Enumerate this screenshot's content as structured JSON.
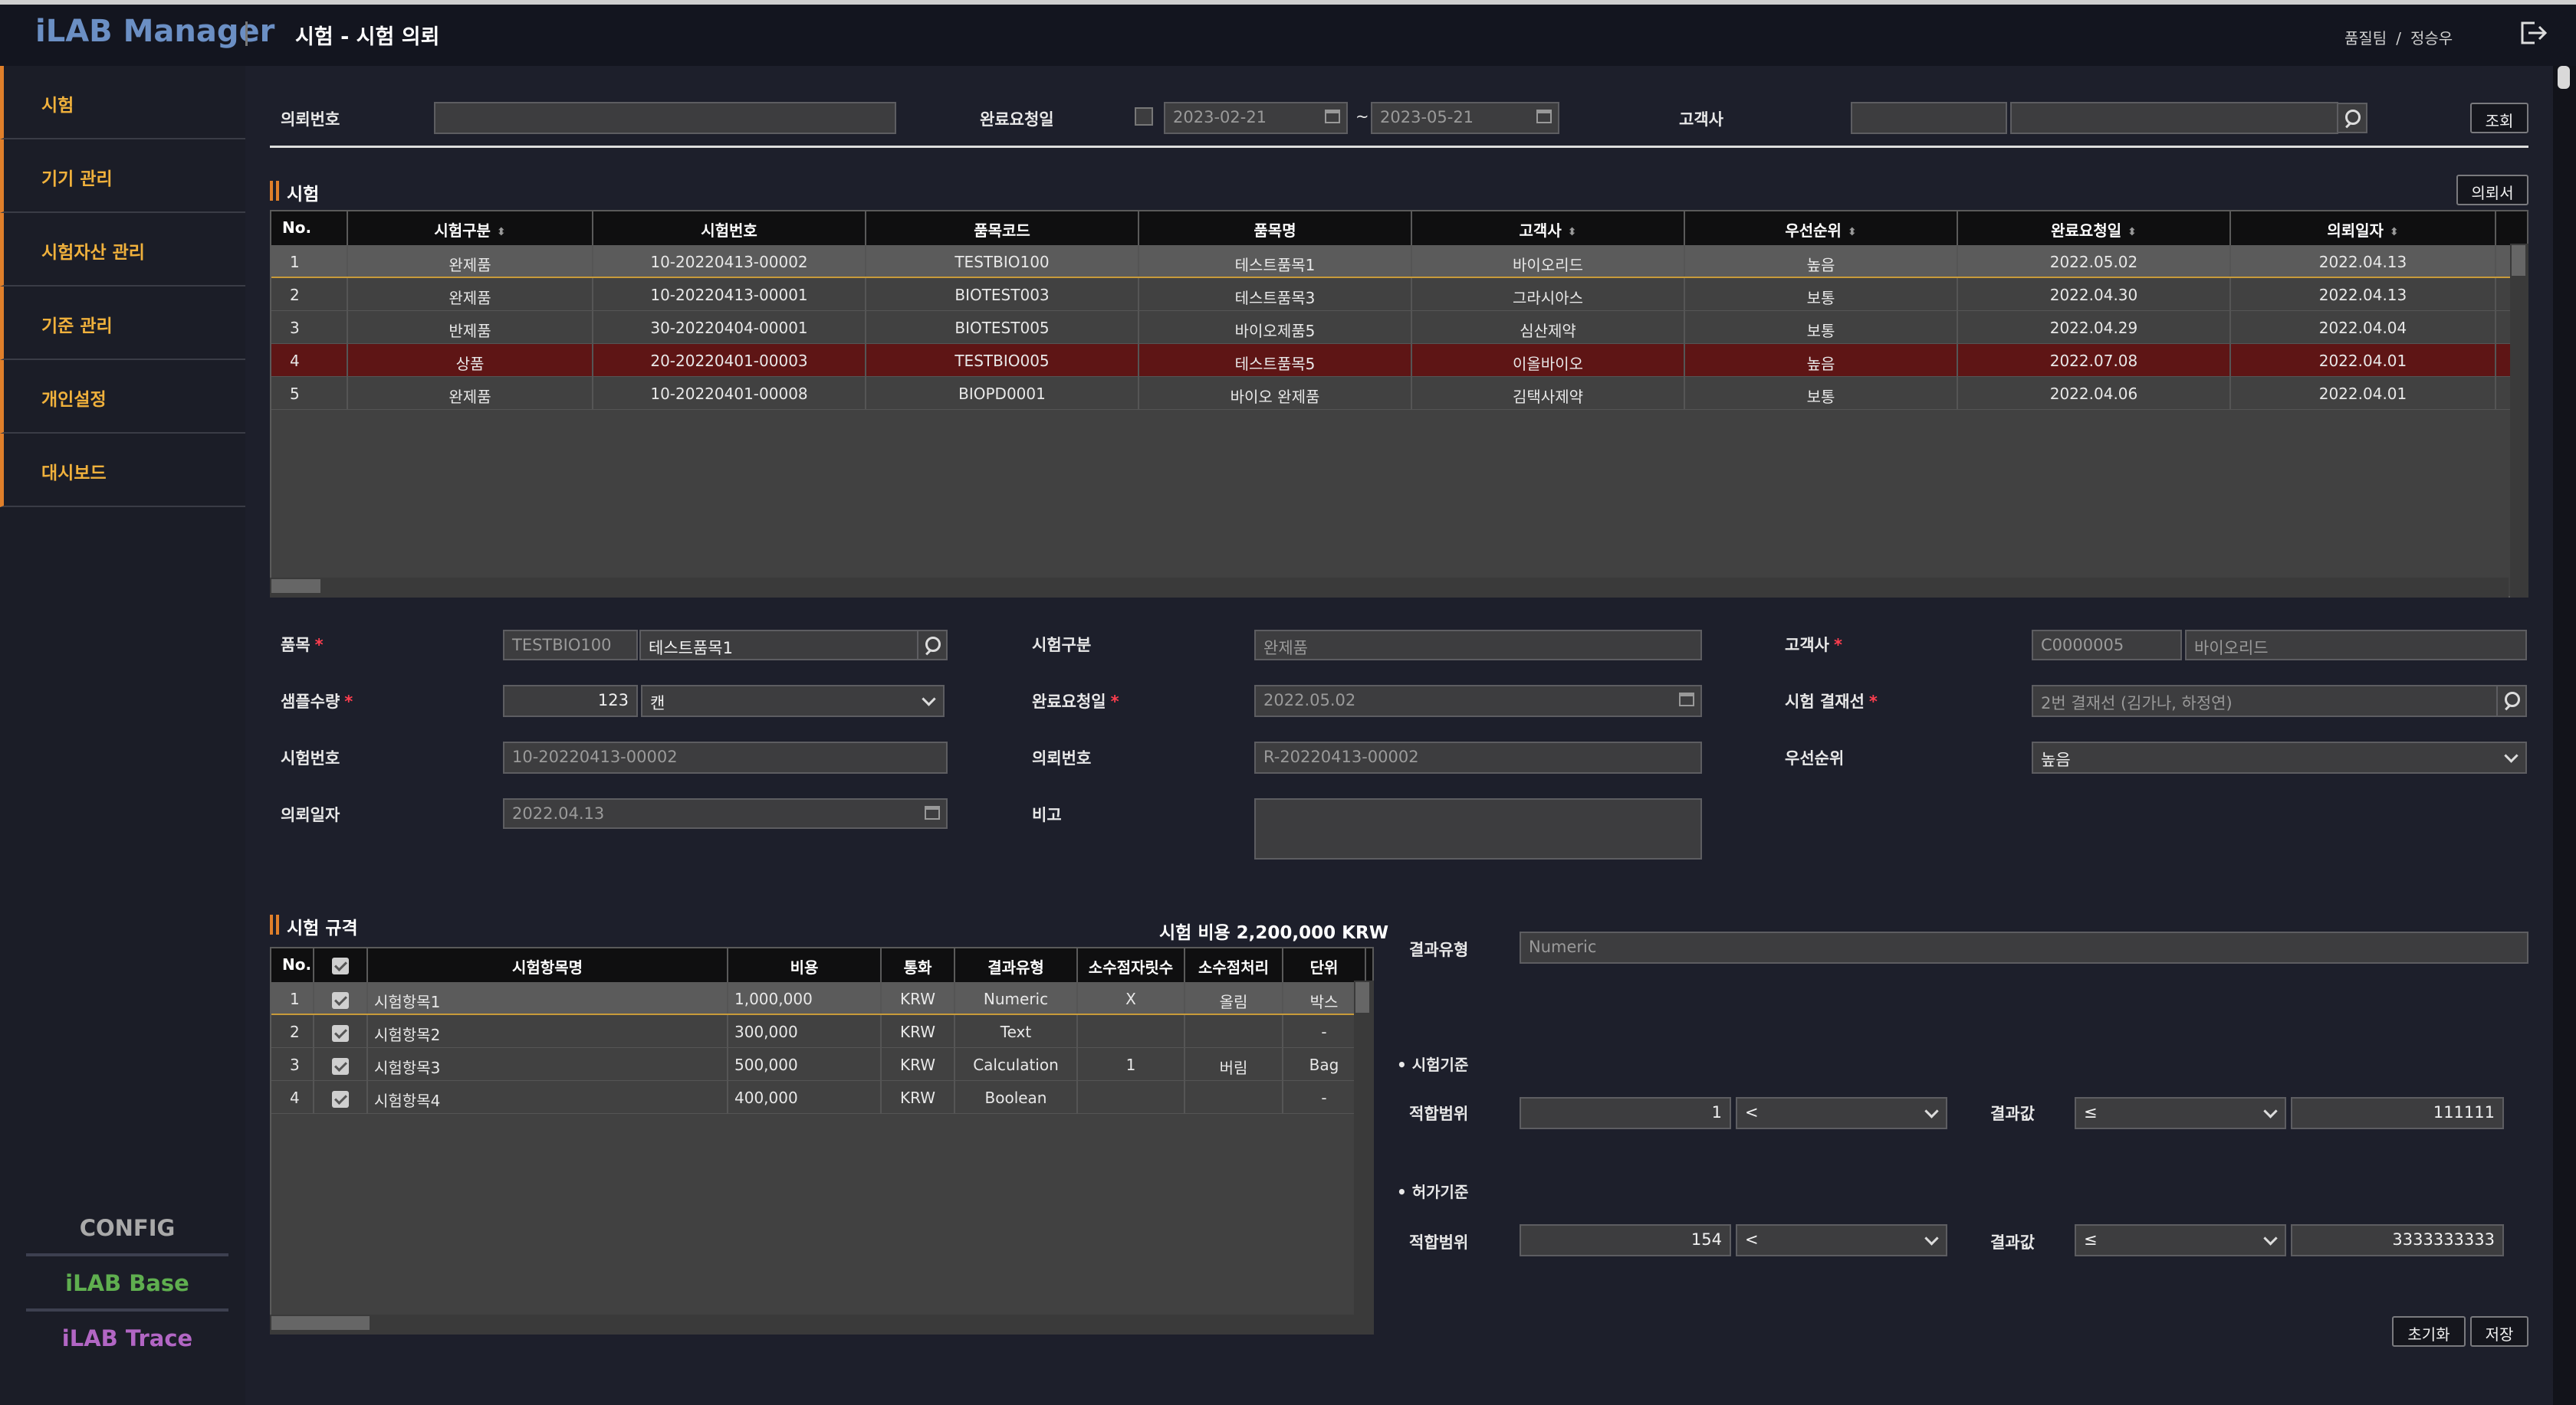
{
  "app": {
    "logo": "iLAB Manager",
    "title": "시험 - 시험 의뢰",
    "user_team": "품질팀",
    "user_sep": "/",
    "user_name": "정승우"
  },
  "sidebar": {
    "items": [
      "시험",
      "기기 관리",
      "시험자산 관리",
      "기준 관리",
      "개인설정",
      "대시보드"
    ],
    "apps": [
      "CONFIG",
      "iLAB Base",
      "iLAB Trace"
    ],
    "app_colors": [
      "#a9a9a9",
      "#5fae4f",
      "#b266c4"
    ]
  },
  "search": {
    "request_no_label": "의뢰번호",
    "due_label": "완료요청일",
    "date_from": "2023-02-21",
    "date_sep": "~",
    "date_to": "2023-05-21",
    "customer_label": "고객사",
    "query_button": "조회"
  },
  "test_section": {
    "title": "시험",
    "request_button": "의뢰서",
    "columns": [
      "No.",
      "시험구분",
      "시험번호",
      "품목코드",
      "품목명",
      "고객사",
      "우선순위",
      "완료요청일",
      "의뢰일자"
    ],
    "rows": [
      [
        "1",
        "완제품",
        "10-20220413-00002",
        "TESTBIO100",
        "테스트품목1",
        "바이오리드",
        "높음",
        "2022.05.02",
        "2022.04.13"
      ],
      [
        "2",
        "완제품",
        "10-20220413-00001",
        "BIOTEST003",
        "테스트품목3",
        "그라시아스",
        "보통",
        "2022.04.30",
        "2022.04.13"
      ],
      [
        "3",
        "반제품",
        "30-20220404-00001",
        "BIOTEST005",
        "바이오제품5",
        "심산제약",
        "보통",
        "2022.04.29",
        "2022.04.04"
      ],
      [
        "4",
        "상품",
        "20-20220401-00003",
        "TESTBIO005",
        "테스트품목5",
        "이올바이오",
        "높음",
        "2022.07.08",
        "2022.04.01"
      ],
      [
        "5",
        "완제품",
        "10-20220401-00008",
        "BIOPD0001",
        "바이오 완제품",
        "김택사제약",
        "보통",
        "2022.04.06",
        "2022.04.01"
      ]
    ]
  },
  "detail": {
    "item_label": "품목",
    "item_code": "TESTBIO100",
    "item_name": "테스트품목1",
    "test_type_label": "시험구분",
    "test_type_value": "완제품",
    "customer_label": "고객사",
    "customer_code": "C0000005",
    "customer_name": "바이오리드",
    "sample_qty_label": "샘플수량",
    "sample_qty": "123",
    "sample_unit": "캔",
    "due_label": "완료요청일",
    "due_value": "2022.05.02",
    "approval_label": "시험 결재선",
    "approval_value": "2번 결재선 (김가나, 하정연)",
    "test_no_label": "시험번호",
    "test_no_value": "10-20220413-00002",
    "request_no_label": "의뢰번호",
    "request_no_value": "R-20220413-00002",
    "priority_label": "우선순위",
    "priority_value": "높음",
    "request_date_label": "의뢰일자",
    "request_date_value": "2022.04.13",
    "note_label": "비고",
    "required_mark": "*"
  },
  "spec": {
    "title": "시험 규격",
    "cost_text": "시험 비용 2,200,000 KRW",
    "columns": [
      "No.",
      "",
      "시험항목명",
      "비용",
      "통화",
      "결과유형",
      "소수점자릿수",
      "소수점처리",
      "단위"
    ],
    "rows": [
      [
        "1",
        "",
        "시험항목1",
        "1,000,000",
        "KRW",
        "Numeric",
        "X",
        "올림",
        "박스"
      ],
      [
        "2",
        "",
        "시험항목2",
        "300,000",
        "KRW",
        "Text",
        "",
        "",
        "-"
      ],
      [
        "3",
        "",
        "시험항목3",
        "500,000",
        "KRW",
        "Calculation",
        "1",
        "버림",
        "Bag"
      ],
      [
        "4",
        "",
        "시험항목4",
        "400,000",
        "KRW",
        "Boolean",
        "",
        "",
        "-"
      ]
    ]
  },
  "criteria": {
    "result_type_label": "결과유형",
    "result_type_value": "Numeric",
    "test_std_label": "시험기준",
    "permit_std_label": "허가기준",
    "range_label": "적합범위",
    "result_label": "결과값",
    "test_range_value": "1",
    "test_range_op": "<",
    "test_result_op": "≤",
    "test_result_value": "111111",
    "permit_range_value": "154",
    "permit_range_op": "<",
    "permit_result_op": "≤",
    "permit_result_value": "3333333333",
    "reset_button": "초기화",
    "save_button": "저장"
  }
}
